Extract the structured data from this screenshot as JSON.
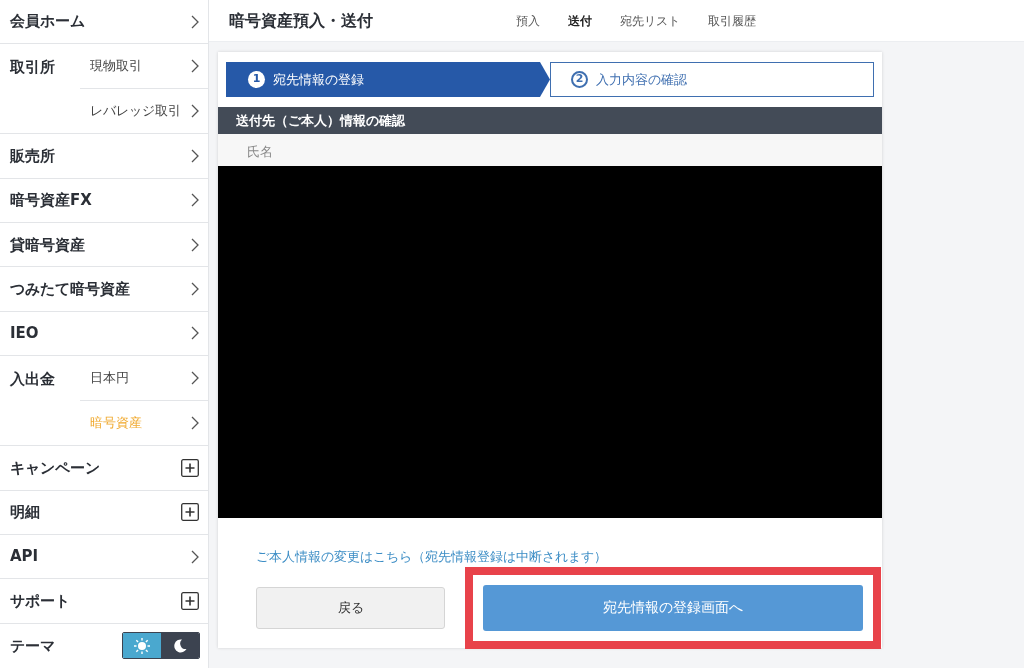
{
  "sidebar": {
    "items": [
      {
        "kind": "link",
        "label": "会員ホーム"
      },
      {
        "kind": "group",
        "label": "取引所",
        "children": [
          {
            "label": "現物取引",
            "selected": false
          },
          {
            "label": "レバレッジ取引",
            "selected": false
          }
        ]
      },
      {
        "kind": "link",
        "label": "販売所"
      },
      {
        "kind": "link",
        "label": "暗号資産FX"
      },
      {
        "kind": "link",
        "label": "貸暗号資産"
      },
      {
        "kind": "link",
        "label": "つみたて暗号資産"
      },
      {
        "kind": "link",
        "label": "IEO"
      },
      {
        "kind": "group",
        "label": "入出金",
        "children": [
          {
            "label": "日本円",
            "selected": false
          },
          {
            "label": "暗号資産",
            "selected": true
          }
        ]
      },
      {
        "kind": "expandable",
        "label": "キャンペーン"
      },
      {
        "kind": "expandable",
        "label": "明細"
      },
      {
        "kind": "link",
        "label": "API"
      },
      {
        "kind": "expandable",
        "label": "サポート"
      },
      {
        "kind": "theme",
        "label": "テーマ",
        "light_selected": true
      }
    ]
  },
  "header": {
    "title": "暗号資産預入・送付",
    "tabs": [
      {
        "label": "預入",
        "selected": false
      },
      {
        "label": "送付",
        "selected": true
      },
      {
        "label": "宛先リスト",
        "selected": false
      },
      {
        "label": "取引履歴",
        "selected": false
      }
    ]
  },
  "steps": [
    {
      "number": "1",
      "label": "宛先情報の登録",
      "selected": true
    },
    {
      "number": "2",
      "label": "入力内容の確認",
      "selected": false
    }
  ],
  "section": {
    "title": "送付先（ご本人）情報の確認",
    "field_label": "氏名"
  },
  "change_link": "ご本人情報の変更はこちら（宛先情報登録は中断されます）",
  "buttons": {
    "back": "戻る",
    "next": "宛先情報の登録画面へ"
  },
  "highlight_next": true
}
